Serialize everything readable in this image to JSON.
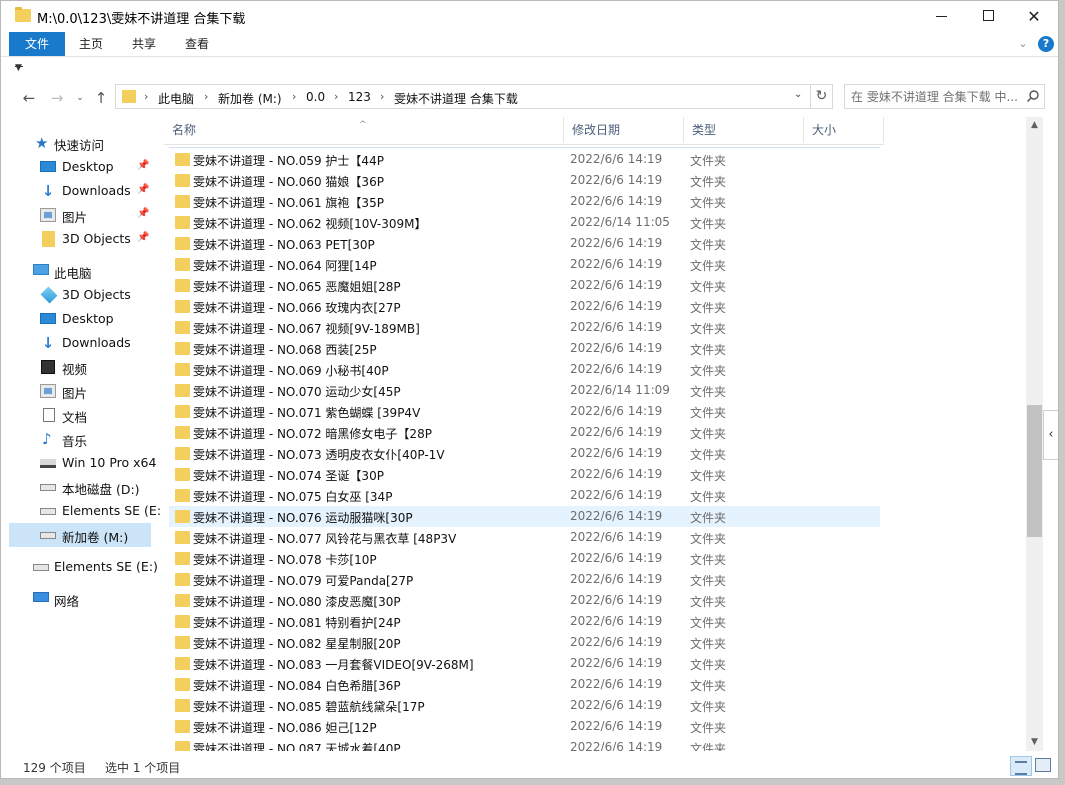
{
  "window": {
    "title": "M:\\0.0\\123\\雯妹不讲道理 合集下载"
  },
  "ribbon": {
    "tabs": [
      "文件",
      "主页",
      "共享",
      "查看"
    ]
  },
  "address": {
    "crumbs": [
      "此电脑",
      "新加卷 (M:)",
      "0.0",
      "123",
      "雯妹不讲道理 合集下载"
    ]
  },
  "search": {
    "placeholder": "在 雯妹不讲道理 合集下载 中..."
  },
  "nav": {
    "quick_access": "快速访问",
    "quick_items": [
      {
        "label": "Desktop",
        "icon": "desktop-icon",
        "pinned": true
      },
      {
        "label": "Downloads",
        "icon": "download-icon",
        "pinned": true
      },
      {
        "label": "图片",
        "icon": "picture-icon",
        "pinned": true
      },
      {
        "label": "3D Objects",
        "icon": "folder-icon",
        "pinned": true
      }
    ],
    "this_pc": "此电脑",
    "pc_items": [
      {
        "label": "3D Objects",
        "icon": "3d-objects-icon"
      },
      {
        "label": "Desktop",
        "icon": "desktop-icon"
      },
      {
        "label": "Downloads",
        "icon": "download-icon"
      },
      {
        "label": "视频",
        "icon": "video-icon"
      },
      {
        "label": "图片",
        "icon": "picture-icon"
      },
      {
        "label": "文档",
        "icon": "document-icon"
      },
      {
        "label": "音乐",
        "icon": "music-icon"
      },
      {
        "label": "Win 10 Pro x64",
        "icon": "windows-drive-icon"
      },
      {
        "label": "本地磁盘 (D:)",
        "icon": "drive-icon"
      },
      {
        "label": "Elements SE (E:",
        "icon": "drive-icon"
      },
      {
        "label": "新加卷 (M:)",
        "icon": "drive-icon",
        "selected": true
      }
    ],
    "external_drive": "Elements SE (E:)",
    "network": "网络"
  },
  "columns": {
    "name": "名称",
    "date": "修改日期",
    "type": "类型",
    "size": "大小"
  },
  "files": [
    {
      "name": "雯妹不讲道理 - NO.059 护士【44P",
      "date": "2022/6/6 14:19",
      "type": "文件夹"
    },
    {
      "name": "雯妹不讲道理 - NO.060 猫娘【36P",
      "date": "2022/6/6 14:19",
      "type": "文件夹"
    },
    {
      "name": "雯妹不讲道理 - NO.061 旗袍【35P",
      "date": "2022/6/6 14:19",
      "type": "文件夹"
    },
    {
      "name": "雯妹不讲道理 - NO.062 视频[10V-309M】",
      "date": "2022/6/14 11:05",
      "type": "文件夹"
    },
    {
      "name": "雯妹不讲道理 - NO.063 PET[30P",
      "date": "2022/6/6 14:19",
      "type": "文件夹"
    },
    {
      "name": "雯妹不讲道理 - NO.064 阿狸[14P",
      "date": "2022/6/6 14:19",
      "type": "文件夹"
    },
    {
      "name": "雯妹不讲道理 - NO.065 恶魔姐姐[28P",
      "date": "2022/6/6 14:19",
      "type": "文件夹"
    },
    {
      "name": "雯妹不讲道理 - NO.066 玫瑰内衣[27P",
      "date": "2022/6/6 14:19",
      "type": "文件夹"
    },
    {
      "name": "雯妹不讲道理 - NO.067 视频[9V-189MB]",
      "date": "2022/6/6 14:19",
      "type": "文件夹"
    },
    {
      "name": "雯妹不讲道理 - NO.068 西装[25P",
      "date": "2022/6/6 14:19",
      "type": "文件夹"
    },
    {
      "name": "雯妹不讲道理 - NO.069 小秘书[40P",
      "date": "2022/6/6 14:19",
      "type": "文件夹"
    },
    {
      "name": "雯妹不讲道理 - NO.070 运动少女[45P",
      "date": "2022/6/14 11:09",
      "type": "文件夹"
    },
    {
      "name": "雯妹不讲道理 - NO.071 紫色蝴蝶 [39P4V",
      "date": "2022/6/6 14:19",
      "type": "文件夹"
    },
    {
      "name": "雯妹不讲道理 - NO.072 暗黑修女电子【28P",
      "date": "2022/6/6 14:19",
      "type": "文件夹"
    },
    {
      "name": "雯妹不讲道理 - NO.073 透明皮衣女仆[40P-1V",
      "date": "2022/6/6 14:19",
      "type": "文件夹"
    },
    {
      "name": "雯妹不讲道理 - NO.074 圣诞【30P",
      "date": "2022/6/6 14:19",
      "type": "文件夹"
    },
    {
      "name": "雯妹不讲道理 - NO.075 白女巫 [34P",
      "date": "2022/6/6 14:19",
      "type": "文件夹"
    },
    {
      "name": "雯妹不讲道理 - NO.076 运动服猫咪[30P",
      "date": "2022/6/6 14:19",
      "type": "文件夹",
      "selected": true
    },
    {
      "name": "雯妹不讲道理 - NO.077 风铃花与黑衣草 [48P3V",
      "date": "2022/6/6 14:19",
      "type": "文件夹"
    },
    {
      "name": "雯妹不讲道理 - NO.078 卡莎[10P",
      "date": "2022/6/6 14:19",
      "type": "文件夹"
    },
    {
      "name": "雯妹不讲道理 - NO.079 可爱Panda[27P",
      "date": "2022/6/6 14:19",
      "type": "文件夹"
    },
    {
      "name": "雯妹不讲道理 - NO.080 漆皮恶魔[30P",
      "date": "2022/6/6 14:19",
      "type": "文件夹"
    },
    {
      "name": "雯妹不讲道理 - NO.081 特别看护[24P",
      "date": "2022/6/6 14:19",
      "type": "文件夹"
    },
    {
      "name": "雯妹不讲道理 - NO.082 星星制服[20P",
      "date": "2022/6/6 14:19",
      "type": "文件夹"
    },
    {
      "name": "雯妹不讲道理 - NO.083 一月套餐VIDEO[9V-268M]",
      "date": "2022/6/6 14:19",
      "type": "文件夹"
    },
    {
      "name": "雯妹不讲道理 - NO.084 白色希腊[36P",
      "date": "2022/6/6 14:19",
      "type": "文件夹"
    },
    {
      "name": "雯妹不讲道理 - NO.085 碧蓝航线黛朵[17P",
      "date": "2022/6/6 14:19",
      "type": "文件夹"
    },
    {
      "name": "雯妹不讲道理 - NO.086 妲己[12P",
      "date": "2022/6/6 14:19",
      "type": "文件夹"
    },
    {
      "name": "雯妹不讲道理 - NO.087 天城水着[40P",
      "date": "2022/6/6 14:19",
      "type": "文件夹"
    }
  ],
  "status": {
    "count": "129 个项目",
    "selected": "选中 1 个项目"
  },
  "colors": {
    "accent": "#1979ca",
    "folder": "#f4cf5e",
    "selection": "#e5f3ff"
  }
}
